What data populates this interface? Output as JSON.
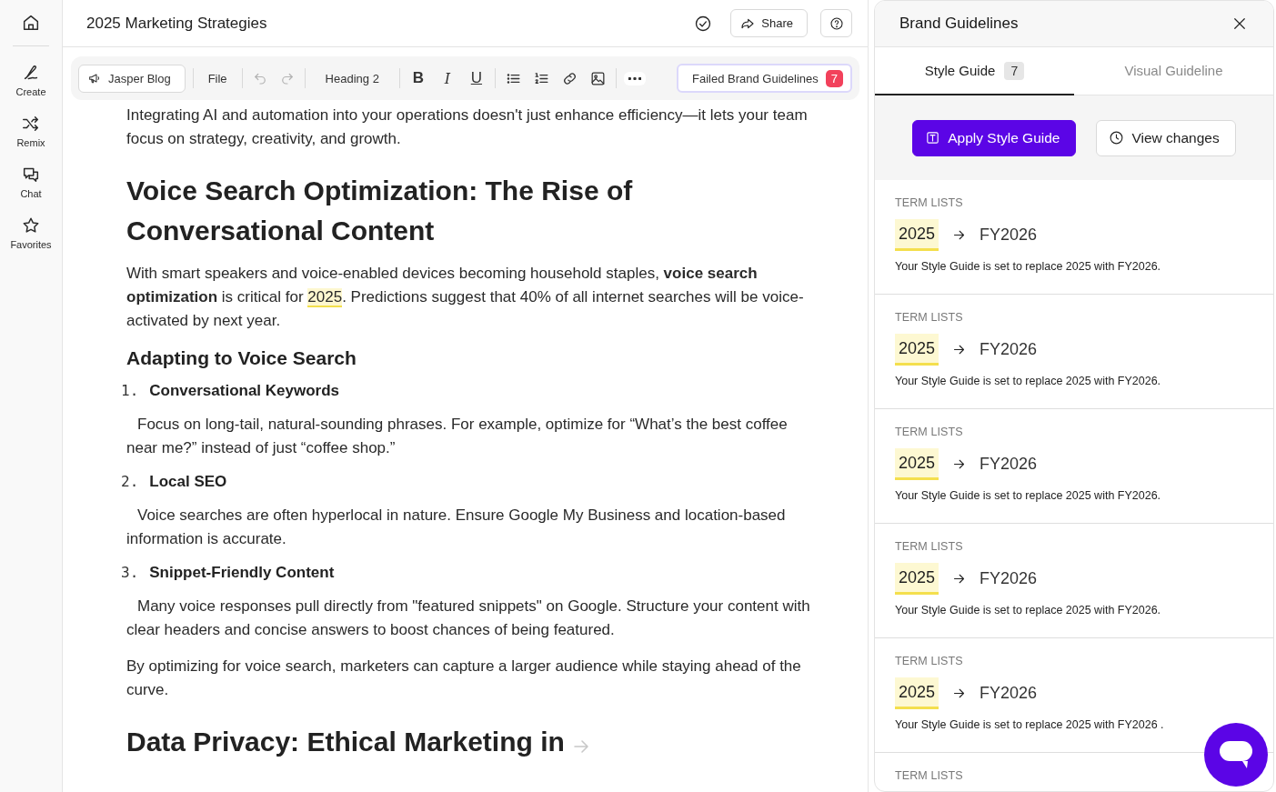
{
  "sidebar": {
    "items": [
      {
        "label": "Create"
      },
      {
        "label": "Remix"
      },
      {
        "label": "Chat"
      },
      {
        "label": "Favorites"
      }
    ]
  },
  "document": {
    "title": "2025 Marketing Strategies",
    "share": "Share"
  },
  "toolbar": {
    "template": "Jasper Blog",
    "file": "File",
    "undo_disabled": true,
    "redo_disabled": true,
    "block_style": "Heading 2",
    "format": [
      "B",
      "I",
      "U"
    ],
    "failed": {
      "label": "Failed Brand Guidelines",
      "count": "7"
    }
  },
  "content": [
    {
      "kind": "paragraph",
      "parts": [
        {
          "text": "Integrating AI and automation into your operations doesn't just enhance efficiency—it lets your team focus on strategy, creativity, and growth.",
          "flagged": false
        }
      ]
    },
    {
      "kind": "h2",
      "text": "Voice Search Optimization: The Rise of Conversational Content"
    },
    {
      "kind": "paragraph",
      "parts": [
        {
          "text": "With smart speakers and voice-enabled devices becoming household staples, **voice search optimization** is critical for ",
          "flagged": false
        },
        {
          "text": "2025",
          "flagged": true
        },
        {
          "text": ". Predictions suggest that 40% of all internet searches will be voice-activated by next year.",
          "flagged": false
        }
      ]
    },
    {
      "kind": "h3",
      "text": "Adapting to Voice Search"
    },
    {
      "kind": "list_item",
      "number": "1.",
      "title": "Conversational Keywords",
      "body": "Focus on long-tail, natural-sounding phrases. For example, optimize for “What’s the best coffee near me?” instead of just “coffee shop.”"
    },
    {
      "kind": "list_item",
      "number": "2.",
      "title": "Local SEO",
      "body": "Voice searches are often hyperlocal in nature. Ensure Google My Business and location-based information is accurate."
    },
    {
      "kind": "list_item",
      "number": "3.",
      "title": "Snippet-Friendly Content",
      "body": "Many voice responses pull directly from \"featured snippets\" on Google. Structure your content with clear headers and concise answers to boost chances of being featured."
    },
    {
      "kind": "paragraph",
      "parts": [
        {
          "text": "By optimizing for voice search, marketers can capture a larger audience while staying ahead of the curve.",
          "flagged": false
        }
      ]
    },
    {
      "kind": "h2",
      "text": "Data Privacy: Ethical Marketing in",
      "trailing_arrow": true
    }
  ],
  "panel": {
    "title": "Brand Guidelines",
    "tabs": [
      {
        "label": "Style Guide",
        "count": "7",
        "selected": true
      },
      {
        "label": "Visual Guideline",
        "selected": false
      }
    ],
    "apply": "Apply Style Guide",
    "view": "View changes",
    "cards": [
      {
        "label": "TERM LISTS",
        "from": "2025",
        "to": "FY2026",
        "description": "Your Style Guide is set to replace 2025 with FY2026."
      },
      {
        "label": "TERM LISTS",
        "from": "2025",
        "to": "FY2026",
        "description": "Your Style Guide is set to replace 2025 with FY2026."
      },
      {
        "label": "TERM LISTS",
        "from": "2025",
        "to": "FY2026",
        "description": "Your Style Guide is set to replace 2025 with FY2026."
      },
      {
        "label": "TERM LISTS",
        "from": "2025",
        "to": "FY2026",
        "description": "Your Style Guide is set to replace 2025 with FY2026."
      },
      {
        "label": "TERM LISTS",
        "from": "2025",
        "to": "FY2026",
        "description": "Your Style Guide is set to replace 2025 with FY2026 ."
      },
      {
        "label": "TERM LISTS"
      }
    ]
  }
}
